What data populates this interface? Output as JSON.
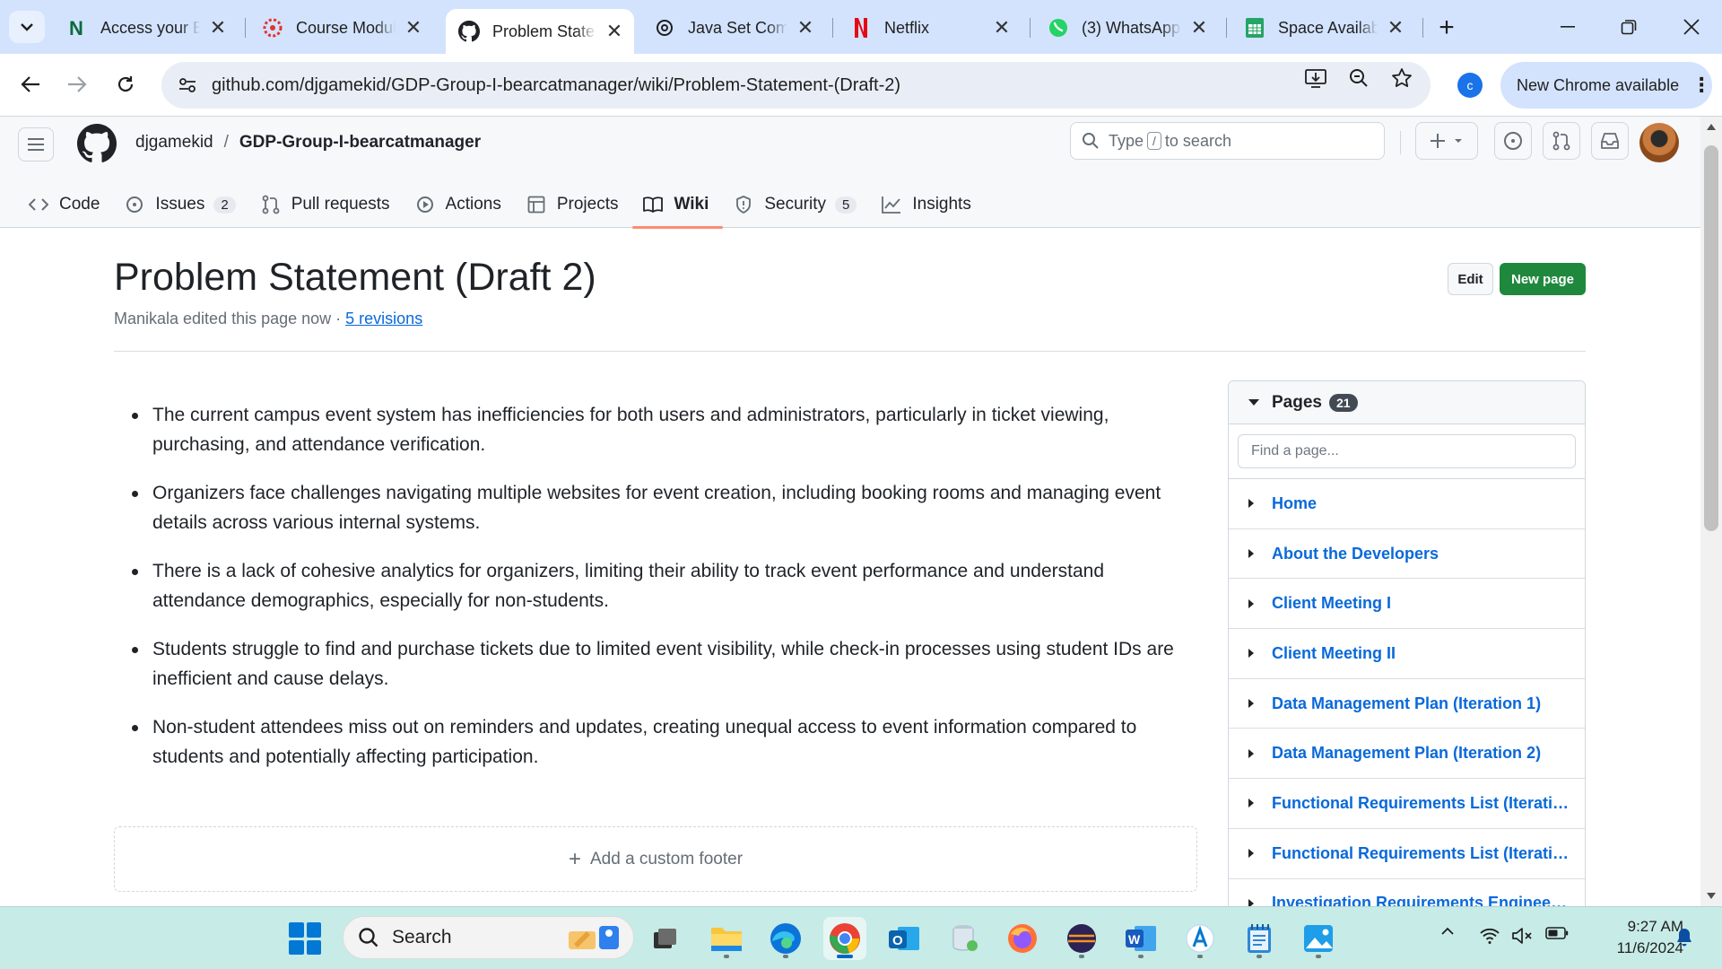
{
  "browser": {
    "tabs": [
      {
        "title": "Access your B",
        "favicon": "notion-n-icon"
      },
      {
        "title": "Course Modul",
        "favicon": "canvas-icon"
      },
      {
        "title": "Problem State",
        "favicon": "github-icon",
        "active": true
      },
      {
        "title": "Java Set Comp",
        "favicon": "chatgpt-icon"
      },
      {
        "title": "Netflix",
        "favicon": "netflix-icon"
      },
      {
        "title": "(3) WhatsApp",
        "favicon": "whatsapp-icon"
      },
      {
        "title": "Space Availab",
        "favicon": "sheets-icon"
      }
    ],
    "url": "github.com/djgamekid/GDP-Group-I-bearcatmanager/wiki/Problem-Statement-(Draft-2)",
    "profile_initial": "c",
    "new_chrome_label": "New Chrome available"
  },
  "github": {
    "owner": "djgamekid",
    "separator": "/",
    "repo": "GDP-Group-I-bearcatmanager",
    "search": {
      "prefix": "Type",
      "key": "/",
      "suffix": "to search"
    },
    "nav": [
      {
        "label": "Code",
        "icon": "code-icon"
      },
      {
        "label": "Issues",
        "icon": "issue-opened-icon",
        "count": "2"
      },
      {
        "label": "Pull requests",
        "icon": "git-pull-request-icon"
      },
      {
        "label": "Actions",
        "icon": "play-icon"
      },
      {
        "label": "Projects",
        "icon": "table-icon"
      },
      {
        "label": "Wiki",
        "icon": "book-icon",
        "selected": true
      },
      {
        "label": "Security",
        "icon": "shield-icon",
        "count": "5"
      },
      {
        "label": "Insights",
        "icon": "graph-icon"
      }
    ]
  },
  "page": {
    "title": "Problem Statement (Draft 2)",
    "meta_text": "Manikala edited this page now · ",
    "revisions_link": "5 revisions",
    "edit_label": "Edit",
    "new_page_label": "New page",
    "bullets": [
      "The current campus event system has inefficiencies for both users and administrators, particularly in ticket viewing, purchasing, and attendance verification.",
      "Organizers face challenges navigating multiple websites for event creation, including booking rooms and managing event details across various internal systems.",
      "There is a lack of cohesive analytics for organizers, limiting their ability to track event performance and understand attendance demographics, especially for non-students.",
      "Students struggle to find and purchase tickets due to limited event visibility, while check-in processes using student IDs are inefficient and cause delays.",
      "Non-student attendees miss out on reminders and updates, creating unequal access to event information compared to students and potentially affecting participation."
    ],
    "footer_label": "Add a custom footer"
  },
  "sidebar": {
    "heading": "Pages",
    "count": "21",
    "find_placeholder": "Find a page...",
    "pages": [
      "Home",
      "About the Developers",
      "Client Meeting I",
      "Client Meeting II",
      "Data Management Plan (Iteration 1)",
      "Data Management Plan (Iteration 2)",
      "Functional Requirements List (Iteratio...",
      "Functional Requirements List (Iteratio...",
      "Investigation Requirements Engineeri..."
    ]
  },
  "taskbar": {
    "search_label": "Search",
    "apps": [
      "file-explorer-icon",
      "taskview-icon",
      "folder-icon",
      "edge-icon",
      "chrome-icon",
      "outlook-icon",
      "database-icon",
      "firefox-icon",
      "eclipse-icon",
      "word-icon",
      "azure-data-studio-icon",
      "notepad-icon",
      "photos-icon"
    ],
    "time": "9:27 AM",
    "date": "11/6/2024"
  },
  "colors": {
    "accent_blue": "#0969da",
    "primary_green": "#1f883d",
    "selected_tab_underline": "#fd8c73",
    "browser_tabstrip": "#d3e3fd",
    "taskbar": "#c7ebe6"
  }
}
